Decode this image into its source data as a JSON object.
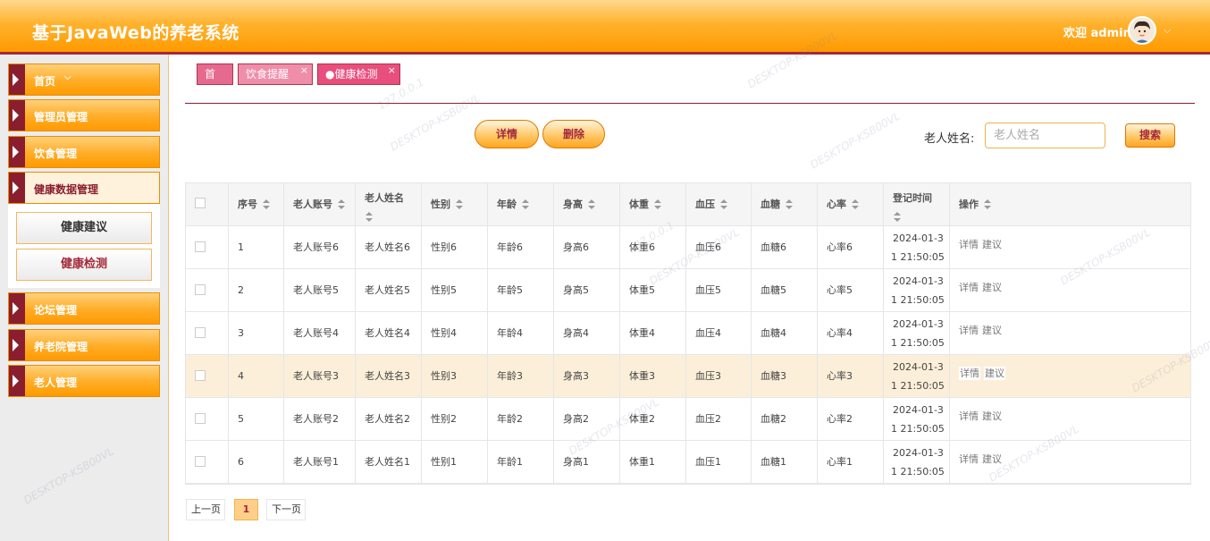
{
  "header": {
    "title": "基于JavaWeb的养老系统",
    "welcome": "欢迎 admin"
  },
  "sidebar": {
    "items": [
      {
        "label": "首页",
        "chevron": "⌵"
      },
      {
        "label": "管理员管理"
      },
      {
        "label": "饮食管理"
      },
      {
        "label": "健康数据管理"
      },
      {
        "label": "论坛管理"
      },
      {
        "label": "养老院管理"
      },
      {
        "label": "老人管理"
      }
    ],
    "sub_items": [
      {
        "label": "健康建议",
        "color": "#333333"
      },
      {
        "label": "健康检测",
        "color": "#a4283a"
      }
    ]
  },
  "tabs": [
    {
      "label": "首页"
    },
    {
      "label": "饮食提醒",
      "close": "×"
    },
    {
      "label": "●健康检测",
      "close": "×"
    }
  ],
  "toolbar": {
    "detail": "详情",
    "delete": "删除",
    "search_label": "老人姓名:",
    "search_placeholder": "老人姓名",
    "search_value": "",
    "search_button": "搜索"
  },
  "table": {
    "headers": [
      "序号",
      "老人账号",
      "老人姓名",
      "性别",
      "年龄",
      "身高",
      "体重",
      "血压",
      "血糖",
      "心率",
      "登记时间",
      "操作"
    ],
    "rows": [
      {
        "no": "1",
        "account": "老人账号6",
        "name": "老人姓名6",
        "gender": "性别6",
        "age": "年龄6",
        "height": "身高6",
        "weight": "体重6",
        "bp": "血压6",
        "sugar": "血糖6",
        "rate": "心率6",
        "time1": "2024-01-3",
        "time2": "1 21:50:05"
      },
      {
        "no": "2",
        "account": "老人账号5",
        "name": "老人姓名5",
        "gender": "性别5",
        "age": "年龄5",
        "height": "身高5",
        "weight": "体重5",
        "bp": "血压5",
        "sugar": "血糖5",
        "rate": "心率5",
        "time1": "2024-01-3",
        "time2": "1 21:50:05"
      },
      {
        "no": "3",
        "account": "老人账号4",
        "name": "老人姓名4",
        "gender": "性别4",
        "age": "年龄4",
        "height": "身高4",
        "weight": "体重4",
        "bp": "血压4",
        "sugar": "血糖4",
        "rate": "心率4",
        "time1": "2024-01-3",
        "time2": "1 21:50:05"
      },
      {
        "no": "4",
        "account": "老人账号3",
        "name": "老人姓名3",
        "gender": "性别3",
        "age": "年龄3",
        "height": "身高3",
        "weight": "体重3",
        "bp": "血压3",
        "sugar": "血糖3",
        "rate": "心率3",
        "time1": "2024-01-3",
        "time2": "1 21:50:05"
      },
      {
        "no": "5",
        "account": "老人账号2",
        "name": "老人姓名2",
        "gender": "性别2",
        "age": "年龄2",
        "height": "身高2",
        "weight": "体重2",
        "bp": "血压2",
        "sugar": "血糖2",
        "rate": "心率2",
        "time1": "2024-01-3",
        "time2": "1 21:50:05"
      },
      {
        "no": "6",
        "account": "老人账号1",
        "name": "老人姓名1",
        "gender": "性别1",
        "age": "年龄1",
        "height": "身高1",
        "weight": "体重1",
        "bp": "血压1",
        "sugar": "血糖1",
        "rate": "心率1",
        "time1": "2024-01-3",
        "time2": "1 21:50:05"
      }
    ],
    "ops": {
      "detail": "详情",
      "advice": "建议"
    }
  },
  "pager": {
    "prev": "上一页",
    "current": "1",
    "next": "下一页"
  },
  "watermark": {
    "ip": "127.0.0.1",
    "host": "DESKTOP-KSB00VL"
  },
  "colors": {
    "header_accent": "#ff9a00",
    "brand_dark": "#a4283a",
    "highlight_row": "#fcefd9"
  }
}
